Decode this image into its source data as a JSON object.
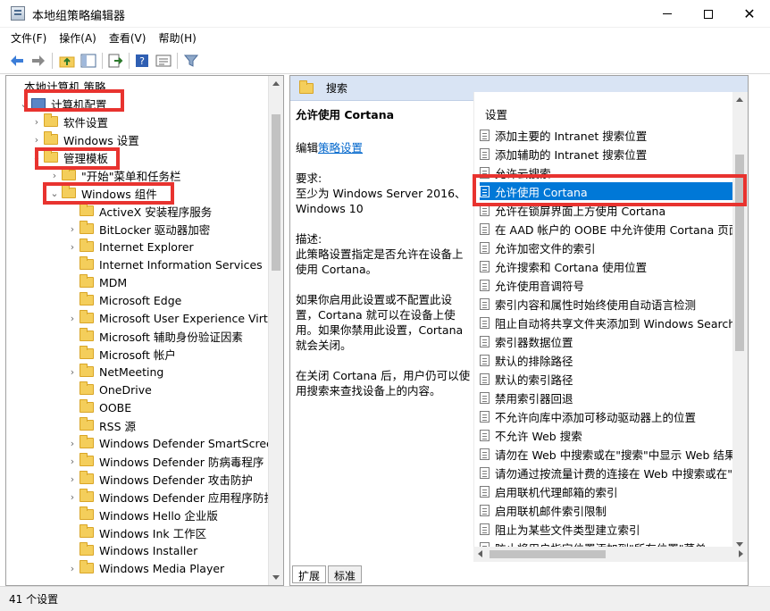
{
  "window": {
    "title": "本地组策略编辑器",
    "min": "",
    "max": "",
    "close": "✕"
  },
  "menu": [
    "文件(F)",
    "操作(A)",
    "查看(V)",
    "帮助(H)"
  ],
  "tree": {
    "items": [
      {
        "label": "本地计算机 策略",
        "level": 0,
        "icon": "computer-policy-icon",
        "chevron": ""
      },
      {
        "label": "计算机配置",
        "level": 1,
        "icon": "computer-icon",
        "chevron": "v"
      },
      {
        "label": "软件设置",
        "level": 2,
        "icon": "folder-icon",
        "chevron": ">"
      },
      {
        "label": "Windows 设置",
        "level": 2,
        "icon": "folder-icon",
        "chevron": ">"
      },
      {
        "label": "管理模板",
        "level": 2,
        "icon": "folder-icon",
        "chevron": "v"
      },
      {
        "label": "\"开始\"菜单和任务栏",
        "level": 3,
        "icon": "folder-icon",
        "chevron": ">"
      },
      {
        "label": "Windows 组件",
        "level": 3,
        "icon": "folder-icon",
        "chevron": "v"
      },
      {
        "label": "ActiveX 安装程序服务",
        "level": 4,
        "icon": "folder-icon",
        "chevron": ""
      },
      {
        "label": "BitLocker 驱动器加密",
        "level": 4,
        "icon": "folder-icon",
        "chevron": ">"
      },
      {
        "label": "Internet Explorer",
        "level": 4,
        "icon": "folder-icon",
        "chevron": ">"
      },
      {
        "label": "Internet Information Services",
        "level": 4,
        "icon": "folder-icon",
        "chevron": ""
      },
      {
        "label": "MDM",
        "level": 4,
        "icon": "folder-icon",
        "chevron": ""
      },
      {
        "label": "Microsoft Edge",
        "level": 4,
        "icon": "folder-icon",
        "chevron": ""
      },
      {
        "label": "Microsoft User Experience Virtua",
        "level": 4,
        "icon": "folder-icon",
        "chevron": ">"
      },
      {
        "label": "Microsoft 辅助身份验证因素",
        "level": 4,
        "icon": "folder-icon",
        "chevron": ""
      },
      {
        "label": "Microsoft 帐户",
        "level": 4,
        "icon": "folder-icon",
        "chevron": ""
      },
      {
        "label": "NetMeeting",
        "level": 4,
        "icon": "folder-icon",
        "chevron": ">"
      },
      {
        "label": "OneDrive",
        "level": 4,
        "icon": "folder-icon",
        "chevron": ""
      },
      {
        "label": "OOBE",
        "level": 4,
        "icon": "folder-icon",
        "chevron": ""
      },
      {
        "label": "RSS 源",
        "level": 4,
        "icon": "folder-icon",
        "chevron": ""
      },
      {
        "label": "Windows Defender SmartScreen",
        "level": 4,
        "icon": "folder-icon",
        "chevron": ">"
      },
      {
        "label": "Windows Defender 防病毒程序",
        "level": 4,
        "icon": "folder-icon",
        "chevron": ">"
      },
      {
        "label": "Windows Defender 攻击防护",
        "level": 4,
        "icon": "folder-icon",
        "chevron": ">"
      },
      {
        "label": "Windows Defender 应用程序防护",
        "level": 4,
        "icon": "folder-icon",
        "chevron": ">"
      },
      {
        "label": "Windows Hello 企业版",
        "level": 4,
        "icon": "folder-icon",
        "chevron": ""
      },
      {
        "label": "Windows Ink 工作区",
        "level": 4,
        "icon": "folder-icon",
        "chevron": ""
      },
      {
        "label": "Windows Installer",
        "level": 4,
        "icon": "folder-icon",
        "chevron": ""
      },
      {
        "label": "Windows Media Player",
        "level": 4,
        "icon": "folder-icon",
        "chevron": ">"
      }
    ]
  },
  "detail": {
    "header": "搜索",
    "policy_title": "允许使用 Cortana",
    "edit_prefix": "编辑",
    "edit_link": "策略设置",
    "requirements_label": "要求:",
    "requirements_text": "至少为 Windows Server 2016、Windows 10",
    "description_label": "描述:",
    "description_text": "此策略设置指定是否允许在设备上使用 Cortana。",
    "paragraph2": "如果你启用此设置或不配置此设置，Cortana 就可以在设备上使用。如果你禁用此设置，Cortana 就会关闭。",
    "paragraph3": "在关闭 Cortana 后，用户仍可以使用搜索来查找设备上的内容。"
  },
  "settings_list": {
    "column_header": "设置",
    "selected_index": 3,
    "items": [
      "添加主要的 Intranet 搜索位置",
      "添加辅助的 Intranet 搜索位置",
      "允许云搜索",
      "允许使用 Cortana",
      "允许在锁屏界面上方使用 Cortana",
      "在 AAD 帐户的 OOBE 中允许使用 Cortana 页面",
      "允许加密文件的索引",
      "允许搜索和 Cortana 使用位置",
      "允许使用音调符号",
      "索引内容和属性时始终使用自动语言检测",
      "阻止自动将共享文件夹添加到 Windows Search 索引",
      "索引器数据位置",
      "默认的排除路径",
      "默认的索引路径",
      "禁用索引器回退",
      "不允许向库中添加可移动驱动器上的位置",
      "不允许 Web 搜索",
      "请勿在 Web 中搜索或在\"搜索\"中显示 Web 结果",
      "请勿通过按流量计费的连接在 Web 中搜索或在\"搜索\"中显示 Web 结果",
      "启用联机代理邮箱的索引",
      "启用联机邮件索引限制",
      "阻止为某些文件类型建立索引",
      "防止将用户指定位置添加到\"所有位置\"菜单"
    ]
  },
  "tabs": [
    "扩展",
    "标准"
  ],
  "status": "41 个设置",
  "colors": {
    "selection": "#0078d7",
    "annotation_red": "#e8332f",
    "header_bg": "#d9e4f4"
  }
}
